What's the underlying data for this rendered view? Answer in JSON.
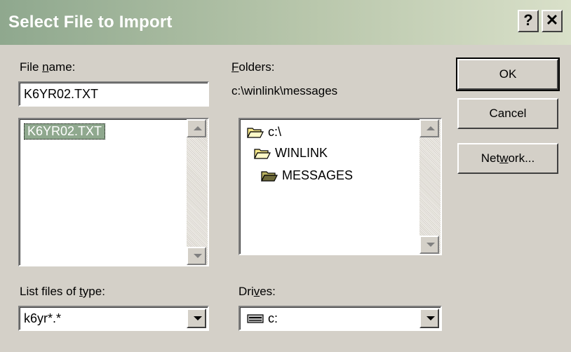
{
  "dialog": {
    "title": "Select File to Import",
    "help_label": "?",
    "close_label": "✕"
  },
  "file_name": {
    "label_prefix": "File ",
    "label_accel": "n",
    "label_suffix": "ame:",
    "value": "K6YR02.TXT",
    "files": [
      "K6YR02.TXT"
    ]
  },
  "folders": {
    "label_accel": "F",
    "label_suffix": "olders:",
    "current_path": "c:\\winlink\\messages",
    "tree": [
      {
        "label": "c:\\",
        "icon": "open-folder-icon"
      },
      {
        "label": "WINLINK",
        "icon": "open-folder-icon"
      },
      {
        "label": "MESSAGES",
        "icon": "open-folder-icon"
      }
    ]
  },
  "buttons": {
    "ok": "OK",
    "cancel": "Cancel",
    "network_prefix": "Net",
    "network_accel": "w",
    "network_suffix": "ork..."
  },
  "file_type": {
    "label_prefix": "List files of ",
    "label_accel": "t",
    "label_suffix": "ype:",
    "value": "k6yr*.*"
  },
  "drives": {
    "label_prefix": "Dri",
    "label_accel": "v",
    "label_suffix": "es:",
    "value": "c:",
    "icon": "drive-icon"
  },
  "colors": {
    "face": "#d4d0c8",
    "selection": "#8fa88e",
    "title_start": "#8fa88e",
    "title_end": "#d9e0c9"
  }
}
